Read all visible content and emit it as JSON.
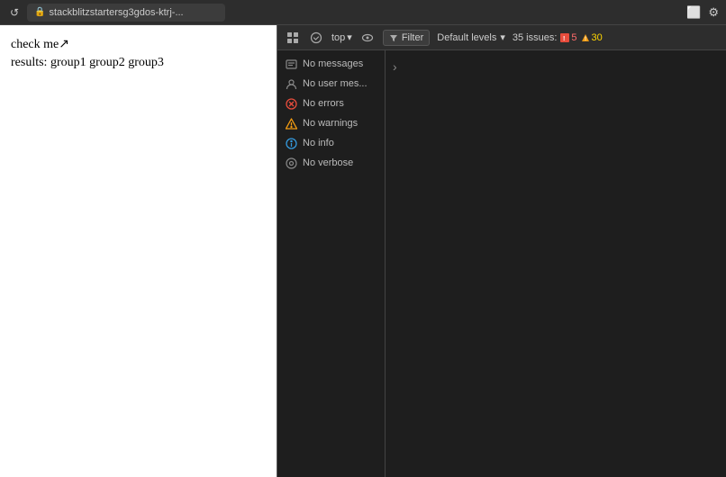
{
  "toolbar": {
    "refresh_icon": "↺",
    "lock_icon": "🔒",
    "url_text": "stackblitzstartersg3gdos-ktrj-...",
    "open_icon": "⬜",
    "settings_icon": "⚙"
  },
  "browser": {
    "line1": "check me",
    "line2": "results: group1 group2 group3"
  },
  "devtools": {
    "topbar": {
      "grid_icon": "⊞",
      "circle_check_icon": "⊙",
      "level_label": "top",
      "eye_icon": "👁",
      "filter_label": "Filter",
      "levels_label": "Default levels",
      "issues_label": "35 issues:",
      "error_count": "5",
      "warning_count": "30"
    },
    "console_items": [
      {
        "icon_type": "messages",
        "label": "No messages"
      },
      {
        "icon_type": "user",
        "label": "No user mes..."
      },
      {
        "icon_type": "error",
        "label": "No errors"
      },
      {
        "icon_type": "warning",
        "label": "No warnings"
      },
      {
        "icon_type": "info",
        "label": "No info"
      },
      {
        "icon_type": "verbose",
        "label": "No verbose"
      }
    ]
  }
}
